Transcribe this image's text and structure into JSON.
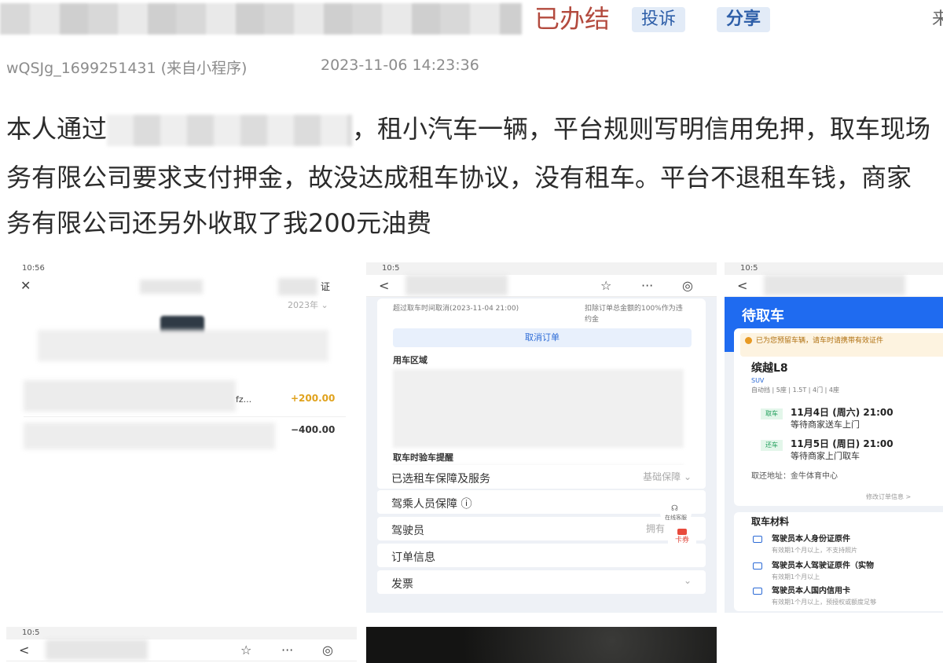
{
  "header": {
    "status": "已办结",
    "complain_label": "投诉",
    "share_label": "分享",
    "cut_char": "来"
  },
  "meta": {
    "user": "wQSJg_1699251431 (来自小程序)",
    "time": "2023-11-06 14:23:36"
  },
  "body": {
    "line1_start": "本人通过",
    "line1_end": "，租小汽车一辆，平台规则写明信用免押，取车现场",
    "line2": "务有限公司要求支付押金，故没达成租车协议，没有租车。平台不退租车钱，商家",
    "line3": "务有限公司还另外收取了我200元油费"
  },
  "shot1": {
    "statusbar": "10:56",
    "close_glyph": "✕",
    "right_label": "证",
    "date_hint": "2023年 ⌄",
    "amount_plus": "+200.00",
    "amount_minus": "−400.00",
    "item_text": "fz..."
  },
  "shot2": {
    "statusbar": "10:5",
    "back_glyph": "<",
    "star_glyph": "☆",
    "more_glyph": "···",
    "target_glyph": "◎",
    "deadline_text": "超过取车时间取消(2023-11-04 21:00)",
    "refund_text": "扣除订单总金额的100%作为违约金",
    "cancel_btn": "取消订单",
    "use_area_title": "用车区域",
    "pickup_title": "取车时验车提醒",
    "rows": [
      {
        "label": "已选租车保障及服务",
        "right": "基础保障 ⌄"
      },
      {
        "label": "驾乘人员保障 ⓘ",
        "right": ""
      },
      {
        "label": "驾驶员",
        "right": "拥有"
      },
      {
        "label": "订单信息",
        "right": ""
      },
      {
        "label": "发票",
        "right": "⌄"
      }
    ],
    "float_service": "在线客服",
    "float_card": "卡券"
  },
  "shot3": {
    "statusbar": "10:5",
    "back_glyph": "<",
    "head_title": "待取车",
    "notice": "已为您预留车辆，请车时请携带有效证件",
    "car_name": "缤越L8",
    "car_spec": "SUV",
    "car_detail": "自动挡 | 5座 | 1.5T | 4门 | 4座",
    "pickup_tag": "取车",
    "pickup_date": "11月4日 (周六) 21:00",
    "pickup_sub": "等待商家送车上门",
    "return_tag": "还车",
    "return_date": "11月5日 (周日) 21:00",
    "return_sub": "等待商家上门取车",
    "address_label": "取还地址：",
    "address": "金牛体育中心",
    "modify_link": "修改订单信息 >",
    "materials_title": "取车材料",
    "mat1": "驾驶员本人身份证原件",
    "mat1_sub": "有效期1个月以上，不支持照片",
    "mat2": "驾驶员本人驾驶证原件（实物",
    "mat2_sub": "有效期1个月以上",
    "mat3": "驾驶员本人国内信用卡",
    "mat3_sub": "有效期1个月以上，预授权或额度足够"
  },
  "shot4": {
    "statusbar": "10:5",
    "back_glyph": "<",
    "star_glyph": "☆",
    "more_glyph": "···",
    "target_glyph": "◎"
  },
  "colors": {
    "status_red": "#b34a3e",
    "pill_bg": "#e2ebf7",
    "pill_text": "#2d5ea8",
    "brand_blue": "#1f6bf0",
    "plus_amount": "#e0a21d"
  }
}
